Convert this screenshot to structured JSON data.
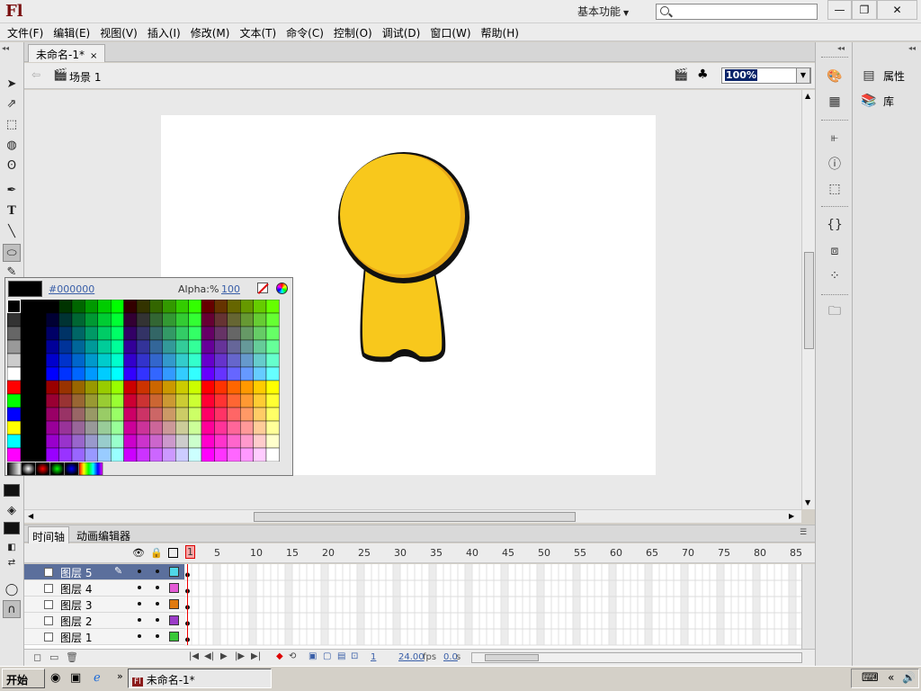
{
  "app": {
    "logo": "Fl",
    "workspace": "基本功能",
    "window_buttons": {
      "minimize": "—",
      "restore": "❐",
      "close": "✕"
    }
  },
  "menu": [
    "文件(F)",
    "编辑(E)",
    "视图(V)",
    "插入(I)",
    "修改(M)",
    "文本(T)",
    "命令(C)",
    "控制(O)",
    "调试(D)",
    "窗口(W)",
    "帮助(H)"
  ],
  "document": {
    "tab_title": "未命名-1*",
    "close": "×",
    "scene": "场景 1",
    "zoom": "100%"
  },
  "swatches": {
    "selected_hex": "#000000",
    "alpha_label": "Alpha:%",
    "alpha_value": "100"
  },
  "timeline": {
    "tabs": [
      "时间轴",
      "动画编辑器"
    ],
    "frame_ticks": [
      "1",
      "5",
      "10",
      "15",
      "20",
      "25",
      "30",
      "35",
      "40",
      "45",
      "50",
      "55",
      "60",
      "65",
      "70",
      "75",
      "80",
      "85"
    ],
    "layers": [
      {
        "name": "图层 5",
        "color": "#4fd6e8",
        "selected": true
      },
      {
        "name": "图层 4",
        "color": "#e45bd6",
        "selected": false
      },
      {
        "name": "图层 3",
        "color": "#e07a10",
        "selected": false
      },
      {
        "name": "图层 2",
        "color": "#9b3cc8",
        "selected": false
      },
      {
        "name": "图层 1",
        "color": "#38c838",
        "selected": false
      }
    ],
    "footer": {
      "current_frame": "1",
      "fps": "24.00",
      "fps_unit": "fps",
      "time": "0.0",
      "time_unit": "s"
    }
  },
  "panels": {
    "properties": "属性",
    "library": "库"
  },
  "taskbar": {
    "start": "开始",
    "task": "未命名-1*",
    "task_icon": "Fl"
  },
  "colors": {
    "character_fill": "#f8c81c",
    "character_shade": "#e8a818",
    "character_outline": "#111111",
    "selected_layer": "#5b6f9c"
  }
}
